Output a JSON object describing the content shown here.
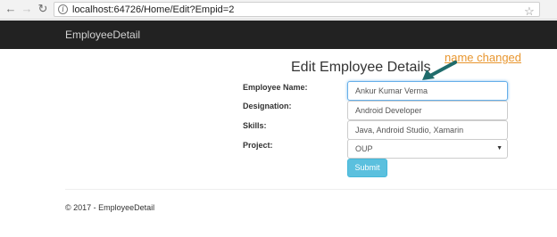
{
  "browser": {
    "url": "localhost:64726/Home/Edit?Empid=2",
    "back_icon": "arrow-left-icon",
    "forward_icon": "arrow-right-icon",
    "reload_icon": "reload-icon",
    "bookmark_icon": "star-icon"
  },
  "navbar": {
    "brand": "EmployeeDetail"
  },
  "page": {
    "title": "Edit Employee Details"
  },
  "annotation": {
    "text": "name changed",
    "color": "#e8962f",
    "arrow_color": "#1f6b6b"
  },
  "form": {
    "fields": [
      {
        "label": "Employee Name:",
        "value": "Ankur  Kumar Verma"
      },
      {
        "label": "Designation:",
        "value": "Android  Developer"
      },
      {
        "label": "Skills:",
        "value": "Java, Android Studio, Xamarin"
      },
      {
        "label": "Project:",
        "value": "OUP"
      }
    ],
    "submit_label": "Submit"
  },
  "footer": {
    "text": "© 2017 - EmployeeDetail"
  },
  "colors": {
    "navbar_bg": "#222222",
    "button_bg": "#5bc0de",
    "focus_border": "#66afe9"
  }
}
